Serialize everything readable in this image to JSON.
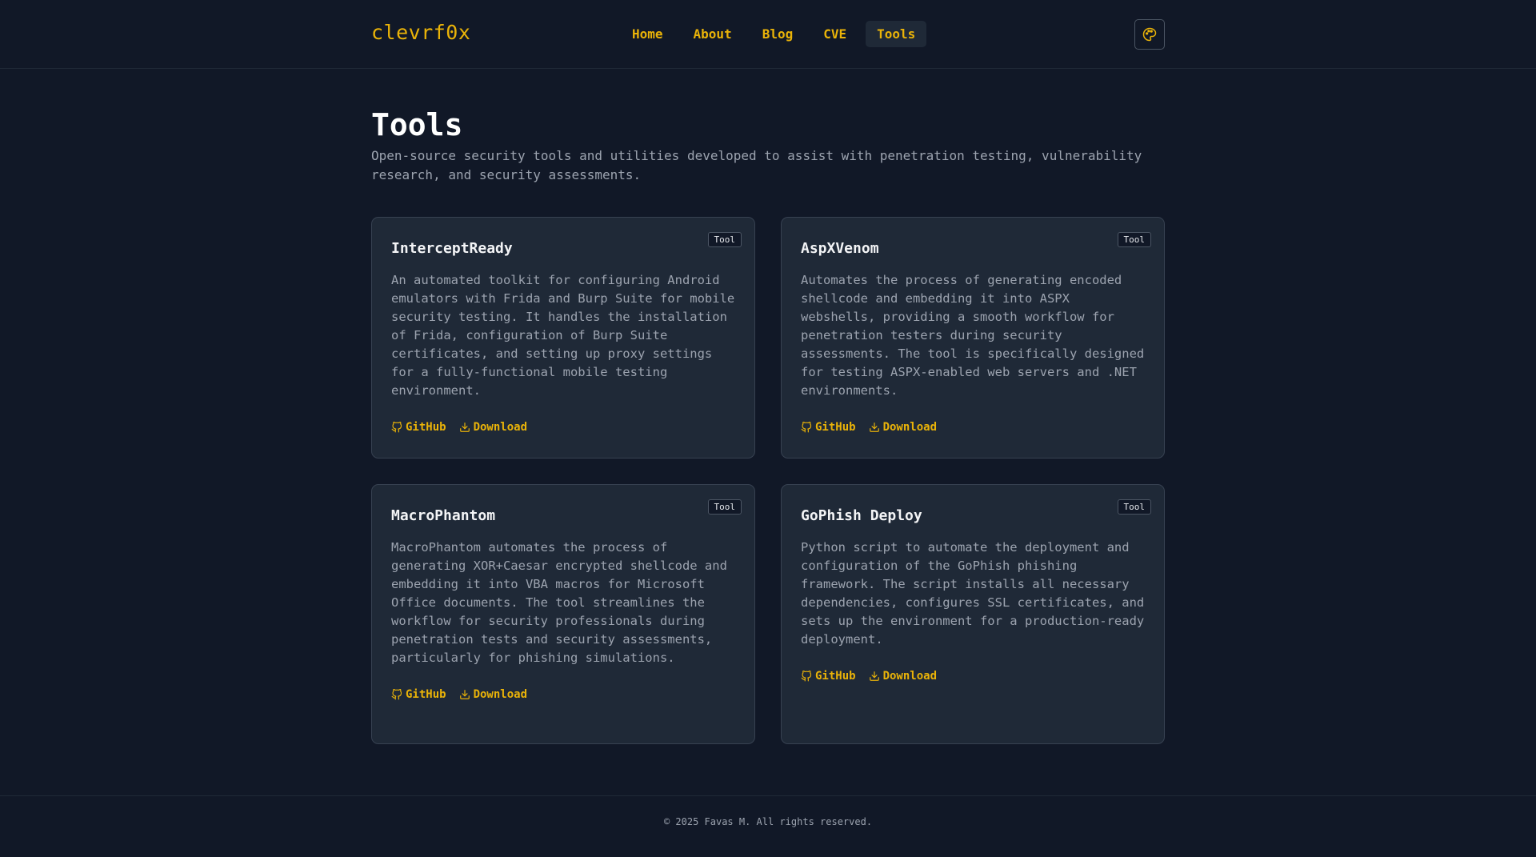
{
  "brand": "clevrf0x",
  "nav": [
    "Home",
    "About",
    "Blog",
    "CVE",
    "Tools"
  ],
  "page": {
    "title": "Tools",
    "description": "Open-source security tools and utilities developed to assist with penetration testing, vulnerability research, and security assessments."
  },
  "cards": [
    {
      "title": "InterceptReady",
      "badge": "Tool",
      "description": "An automated toolkit for configuring Android emulators with Frida and Burp Suite for mobile security testing. It handles the installation of Frida, configuration of Burp Suite certificates, and setting up proxy settings for a fully-functional mobile testing environment.",
      "github": "GitHub",
      "download": "Download"
    },
    {
      "title": "AspXVenom",
      "badge": "Tool",
      "description": "Automates the process of generating encoded shellcode and embedding it into ASPX webshells, providing a smooth workflow for penetration testers during security assessments. The tool is specifically designed for testing ASPX-enabled web servers and .NET environments.",
      "github": "GitHub",
      "download": "Download"
    },
    {
      "title": "MacroPhantom",
      "badge": "Tool",
      "description": "MacroPhantom automates the process of generating XOR+Caesar encrypted shellcode and embedding it into VBA macros for Microsoft Office documents. The tool streamlines the workflow for security professionals during penetration tests and security assessments, particularly for phishing simulations.",
      "github": "GitHub",
      "download": "Download"
    },
    {
      "title": "GoPhish Deploy",
      "badge": "Tool",
      "description": "Python script to automate the deployment and configuration of the GoPhish phishing framework. The script installs all necessary dependencies, configures SSL certificates, and sets up the environment for a production-ready deployment.",
      "github": "GitHub",
      "download": "Download"
    }
  ],
  "footer": "© 2025 Favas M. All rights reserved.",
  "colors": {
    "background": "#111827",
    "card": "#1f2937",
    "accent": "#eab308"
  },
  "icons": {
    "theme": "palette-icon",
    "github": "github-icon",
    "download": "download-icon"
  }
}
